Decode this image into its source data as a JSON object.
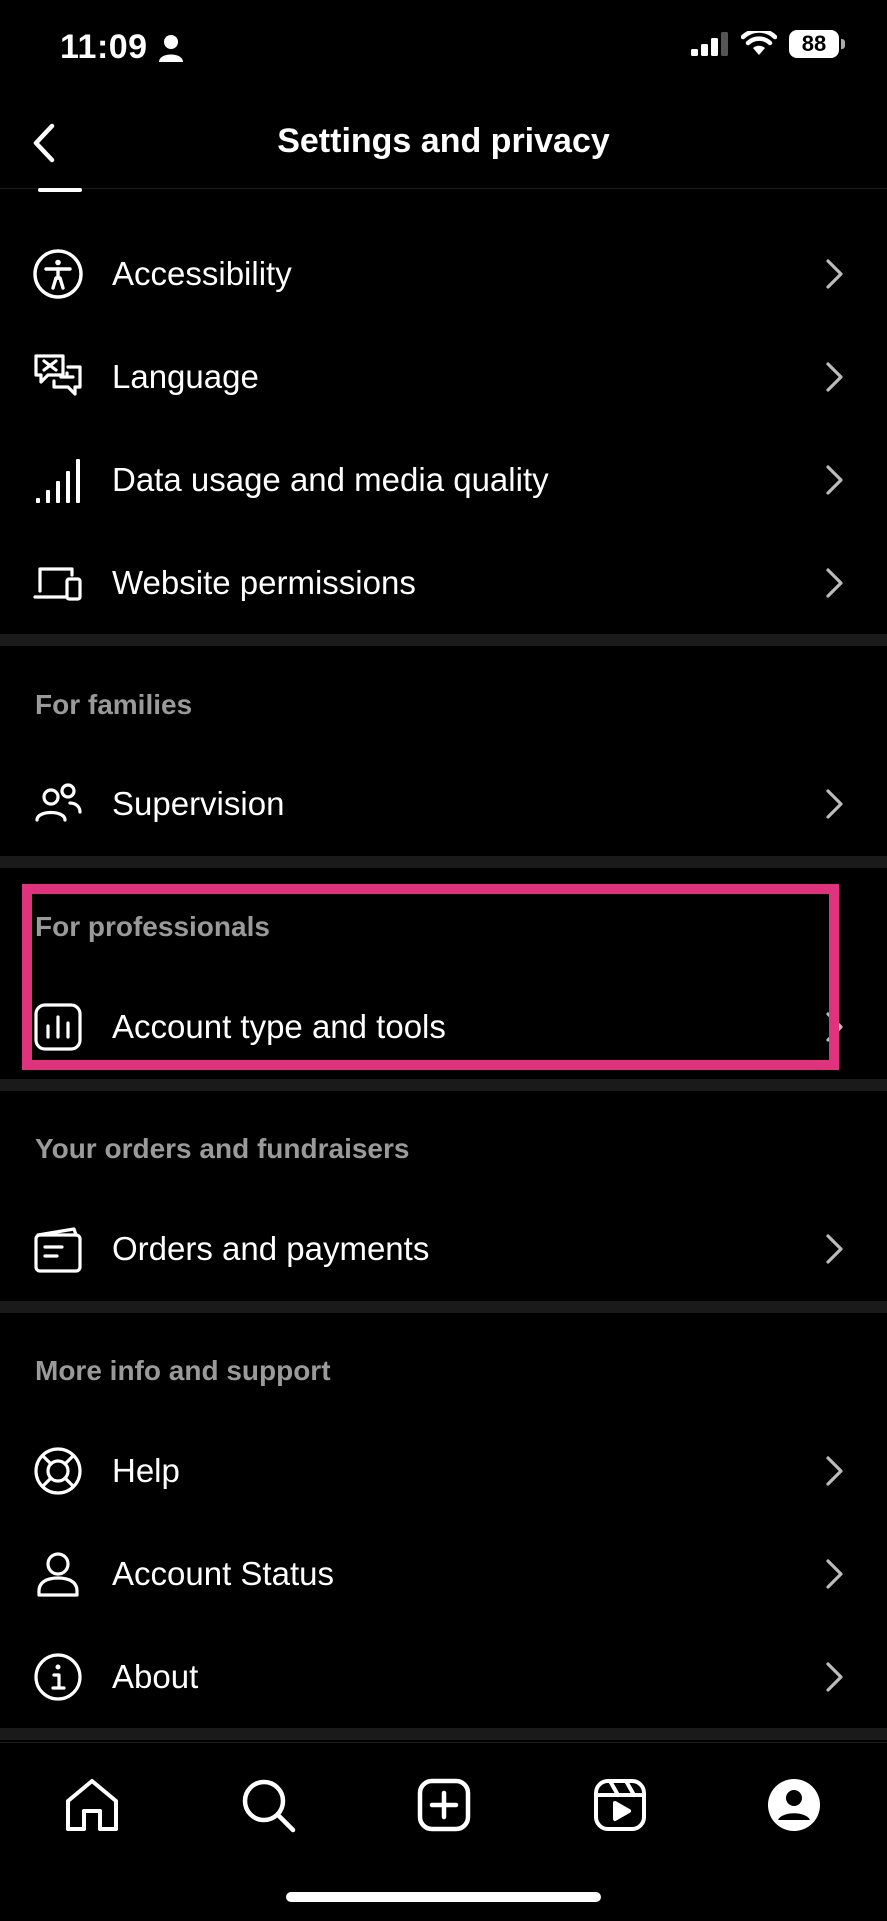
{
  "status_bar": {
    "time": "11:09",
    "battery": "88"
  },
  "header": {
    "title": "Settings and privacy"
  },
  "rows_top": [
    {
      "label": "Accessibility",
      "icon": "accessibility-icon"
    },
    {
      "label": "Language",
      "icon": "language-icon"
    },
    {
      "label": "Data usage and media quality",
      "icon": "signal-bars-icon"
    },
    {
      "label": "Website permissions",
      "icon": "devices-icon"
    }
  ],
  "families": {
    "title": "For families",
    "items": [
      {
        "label": "Supervision",
        "icon": "supervision-icon"
      }
    ]
  },
  "professionals": {
    "title": "For professionals",
    "items": [
      {
        "label": "Account type and tools",
        "icon": "insights-icon"
      }
    ]
  },
  "orders": {
    "title": "Your orders and fundraisers",
    "items": [
      {
        "label": "Orders and payments",
        "icon": "receipt-icon"
      }
    ]
  },
  "support": {
    "title": "More info and support",
    "items": [
      {
        "label": "Help",
        "icon": "lifebuoy-icon"
      },
      {
        "label": "Account Status",
        "icon": "person-icon"
      },
      {
        "label": "About",
        "icon": "info-icon"
      }
    ]
  },
  "tab_bar": {
    "tabs": [
      "home-icon",
      "search-icon",
      "create-icon",
      "reels-icon",
      "profile-icon"
    ]
  },
  "colors": {
    "highlight": "#e0337e",
    "section_title": "#9a9a9a",
    "background": "#000000"
  }
}
